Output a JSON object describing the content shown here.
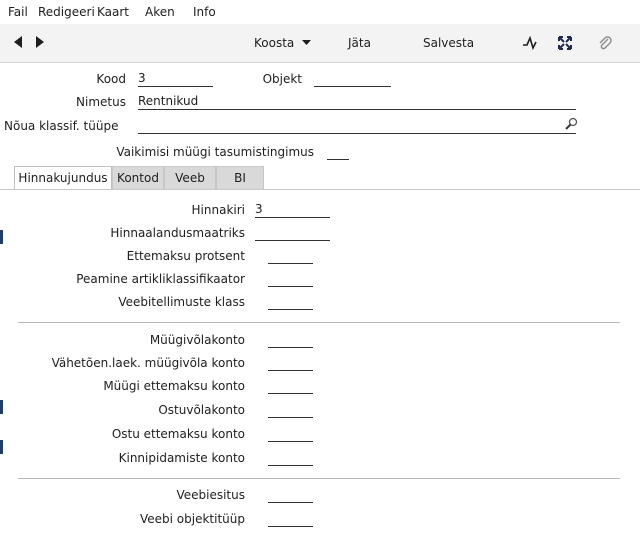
{
  "menu": [
    "Fail",
    "Redigeeri",
    "Kaart",
    "Aken",
    "Info"
  ],
  "toolbar": {
    "koosta": "Koosta",
    "jata": "Jäta",
    "salvesta": "Salvesta"
  },
  "header": {
    "kood_label": "Kood",
    "kood_value": "3",
    "objekt_label": "Objekt",
    "objekt_value": "",
    "nimetus_label": "Nimetus",
    "nimetus_value": "Rentnikud",
    "noua_label": "Nõua klassif. tüüpe",
    "noua_value": "",
    "vaikimisi_label": "Vaikimisi müügi tasumistingimus",
    "vaikimisi_value": ""
  },
  "tabs": [
    "Hinnakujundus",
    "Kontod",
    "Veeb",
    "BI"
  ],
  "fields": {
    "hinnakiri_label": "Hinnakiri",
    "hinnakiri_value": "3",
    "hinnaalandus_label": "Hinnaalandusmaatriks",
    "ettemaksu_label": "Ettemaksu protsent",
    "artikli_label": "Peamine artikliklassifikaator",
    "veebitellimuste_label": "Veebitellimuste klass",
    "myygivolakonto_label": "Müügivõlakonto",
    "vahetoen_label": "Vähetõen.laek. müügivõla konto",
    "myygi_ettemaksu_label": "Müügi ettemaksu konto",
    "ostuvolakonto_label": "Ostuvõlakonto",
    "ostu_ettemaksu_label": "Ostu ettemaksu konto",
    "kinnipidamiste_label": "Kinnipidamiste konto",
    "veebiesitus_label": "Veebiesitus",
    "veebi_objektityyp_label": "Veebi objektitüüp"
  }
}
